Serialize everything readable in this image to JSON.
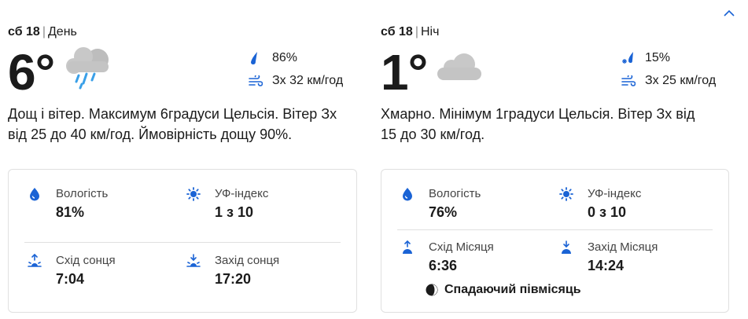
{
  "colors": {
    "accent": "#1a63d5",
    "text": "#1b1b1b",
    "muted": "#8a8a8a",
    "border": "#e0e0e0"
  },
  "day": {
    "date": "сб 18",
    "period": "День",
    "temperature": "6°",
    "condition_icon": "rain-cloud-icon",
    "precip_value": "86%",
    "wind_value": "Зх 32 км/год",
    "description": "Дощ і вітер. Максимум 6градуси Цельсія. Вітер Зх від 25 до 40 км/год. Ймовірність дощу 90%.",
    "details": {
      "humidity_label": "Вологість",
      "humidity_value": "81%",
      "uv_label": "УФ-індекс",
      "uv_value": "1 з 10",
      "rise_label": "Схід сонця",
      "rise_value": "7:04",
      "set_label": "Захід сонця",
      "set_value": "17:20"
    }
  },
  "night": {
    "date": "сб 18",
    "period": "Ніч",
    "temperature": "1°",
    "condition_icon": "cloud-icon",
    "precip_value": "15%",
    "wind_value": "Зх 25 км/год",
    "description": "Хмарно. Мінімум 1градуси Цельсія. Вітер Зх від 15 до 30 км/год.",
    "details": {
      "humidity_label": "Вологість",
      "humidity_value": "76%",
      "uv_label": "УФ-індекс",
      "uv_value": "0 з 10",
      "rise_label": "Схід Місяця",
      "rise_value": "6:36",
      "set_label": "Захід Місяця",
      "set_value": "14:24",
      "moon_phase": "Спадаючий півмісяць"
    }
  }
}
